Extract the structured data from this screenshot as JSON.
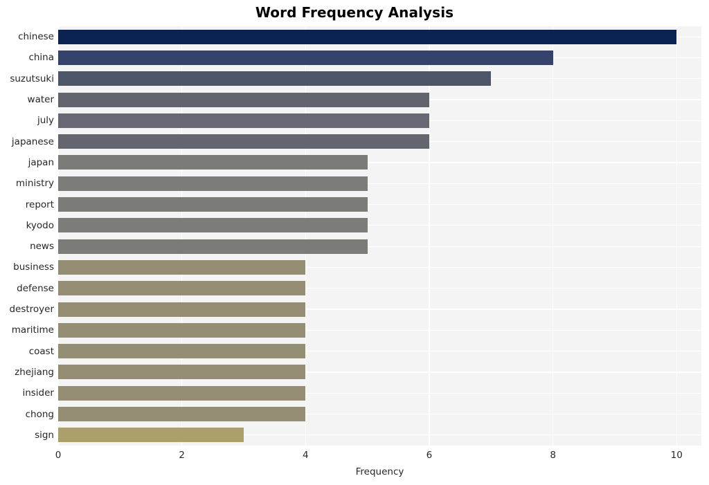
{
  "chart_data": {
    "type": "bar",
    "orientation": "horizontal",
    "title": "Word Frequency Analysis",
    "xlabel": "Frequency",
    "ylabel": "",
    "categories": [
      "chinese",
      "china",
      "suzutsuki",
      "water",
      "july",
      "japanese",
      "japan",
      "ministry",
      "report",
      "kyodo",
      "news",
      "business",
      "defense",
      "destroyer",
      "maritime",
      "coast",
      "zhejiang",
      "insider",
      "chong",
      "sign"
    ],
    "values": [
      10,
      8,
      7,
      6,
      6,
      6,
      5,
      5,
      5,
      5,
      5,
      4,
      4,
      4,
      4,
      4,
      4,
      4,
      4,
      3
    ],
    "bar_colors": [
      "#0b2350",
      "#35426b",
      "#4d5569",
      "#63656e",
      "#676873",
      "#64666f",
      "#7b7b77",
      "#7c7c78",
      "#7b7b77",
      "#7c7c78",
      "#7b7b77",
      "#948d74",
      "#958e75",
      "#948d74",
      "#958e75",
      "#948e75",
      "#948d74",
      "#958e75",
      "#948d74",
      "#aba069"
    ],
    "xlim": [
      0,
      10.4
    ],
    "xticks": [
      "0",
      "2",
      "4",
      "6",
      "8",
      "10"
    ],
    "xtick_values": [
      0,
      2,
      4,
      6,
      8,
      10
    ],
    "grid": true,
    "grid_color": "#ffffff",
    "plot_background": "#f4f4f5",
    "figure_background": "#ffffff",
    "legend": null
  }
}
